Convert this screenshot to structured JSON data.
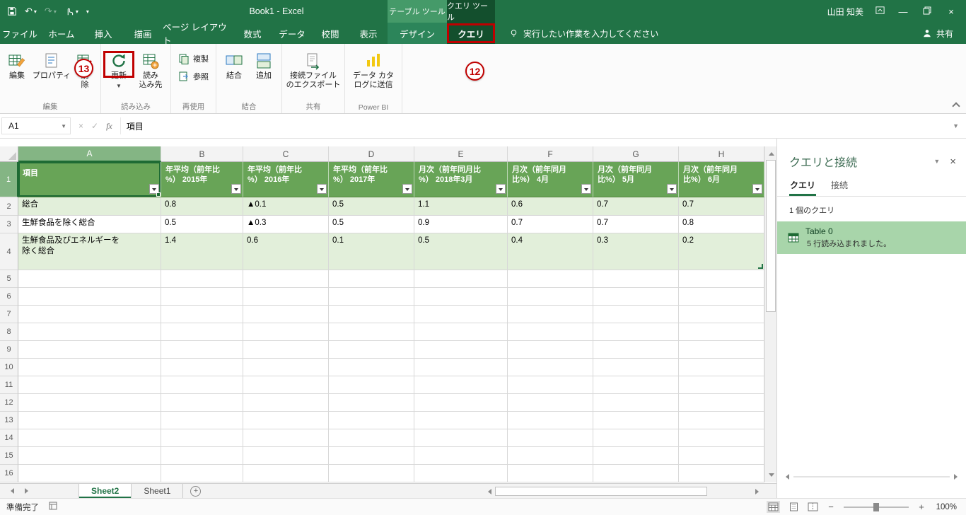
{
  "titlebar": {
    "title": "Book1  -  Excel",
    "user": "山田 知美",
    "table_tools": "テーブル ツール",
    "query_tools": "クエリ ツール"
  },
  "menu": {
    "file": "ファイル",
    "tabs": [
      "ホーム",
      "挿入",
      "描画",
      "ページ レイアウト",
      "数式",
      "データ",
      "校閲",
      "表示"
    ],
    "design_tab": "デザイン",
    "query_tab": "クエリ",
    "tell_me": "実行したい作業を入力してください",
    "share": "共有"
  },
  "ribbon": {
    "groups": {
      "edit": {
        "label": "編集",
        "edit": "編集",
        "properties": "プロパティ",
        "delete": "削\n除"
      },
      "load": {
        "label": "読み込み",
        "refresh": "更新",
        "load_to": "読み\n込み先"
      },
      "reuse": {
        "label": "再使用",
        "duplicate": "複製",
        "reference": "参照"
      },
      "combine": {
        "label": "結合",
        "merge": "結合",
        "append": "追加"
      },
      "share": {
        "label": "共有",
        "export": "接続ファイル\nのエクスポート"
      },
      "powerbi": {
        "label": "Power BI",
        "send": "データ カタ\nログに送信"
      }
    }
  },
  "formula_bar": {
    "name_box": "A1",
    "formula": "項目"
  },
  "grid": {
    "col_headers": [
      "A",
      "B",
      "C",
      "D",
      "E",
      "F",
      "G",
      "H"
    ],
    "row_headers": [
      "1",
      "2",
      "3",
      "4",
      "5",
      "6",
      "7",
      "8",
      "9",
      "10",
      "11",
      "12",
      "13",
      "14",
      "15",
      "16"
    ],
    "table_header": [
      "項目",
      "年平均（前年比\n%） 2015年",
      "年平均（前年比\n%） 2016年",
      "年平均（前年比\n%） 2017年",
      "月次（前年同月比\n%） 2018年3月",
      "月次（前年同月\n比%） 4月",
      "月次（前年同月\n比%） 5月",
      "月次（前年同月\n比%） 6月"
    ],
    "data_rows": [
      {
        "label": "総合",
        "values": [
          "0.8",
          "▲0.1",
          "0.5",
          "1.1",
          "0.6",
          "0.7",
          "0.7"
        ]
      },
      {
        "label": "生鮮食品を除く総合",
        "values": [
          "0.5",
          "▲0.3",
          "0.5",
          "0.9",
          "0.7",
          "0.7",
          "0.8"
        ]
      },
      {
        "label": "生鮮食品及びエネルギーを\n除く総合",
        "values": [
          "1.4",
          "0.6",
          "0.1",
          "0.5",
          "0.4",
          "0.3",
          "0.2"
        ]
      }
    ]
  },
  "pane": {
    "title": "クエリと接続",
    "tab_queries": "クエリ",
    "tab_connections": "接続",
    "count": "1 個のクエリ",
    "query": {
      "name": "Table 0",
      "status": "5 行読み込まれました。"
    }
  },
  "sheet_bar": {
    "sheet2": "Sheet2",
    "sheet1": "Sheet1"
  },
  "status_bar": {
    "ready": "準備完了",
    "zoom": "100%"
  },
  "annotations": {
    "step12": "12",
    "step13": "13"
  },
  "icons": {
    "undo": "↶",
    "redo": "↷",
    "qat_dropdown": "▾",
    "minimize": "—",
    "close": "×",
    "namebox_dropdown": "▼",
    "cancel": "×",
    "enter": "✓",
    "fx": "fx",
    "formula_chevron": "▼",
    "pane_chevron": "▼",
    "pane_close": "×",
    "refresh_dropdown": "▼",
    "new_sheet": "+",
    "zoom_out": "−",
    "zoom_in": "+"
  },
  "colors": {
    "accent": "#217346",
    "table_header": "#68A457",
    "banded_row": "#E2EFDA",
    "annotation": "#C00000"
  }
}
